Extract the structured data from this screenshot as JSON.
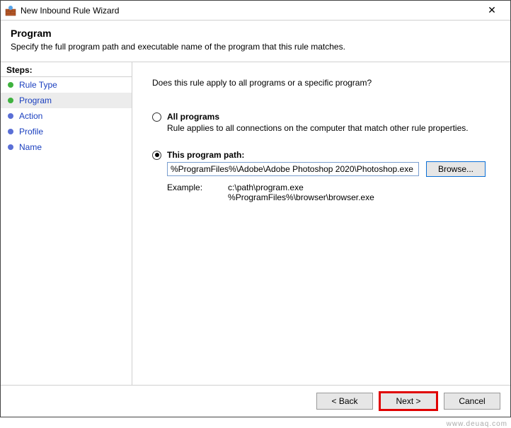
{
  "window": {
    "title": "New Inbound Rule Wizard"
  },
  "header": {
    "title": "Program",
    "subtitle": "Specify the full program path and executable name of the program that this rule matches."
  },
  "sidebar": {
    "heading": "Steps:",
    "items": [
      {
        "label": "Rule Type",
        "state": "done"
      },
      {
        "label": "Program",
        "state": "done",
        "current": true
      },
      {
        "label": "Action",
        "state": "pending"
      },
      {
        "label": "Profile",
        "state": "pending"
      },
      {
        "label": "Name",
        "state": "pending"
      }
    ]
  },
  "content": {
    "question": "Does this rule apply to all programs or a specific program?",
    "option_all": {
      "label": "All programs",
      "desc": "Rule applies to all connections on the computer that match other rule properties.",
      "selected": false
    },
    "option_path": {
      "label": "This program path:",
      "selected": true,
      "value": "%ProgramFiles%\\Adobe\\Adobe Photoshop 2020\\Photoshop.exe",
      "browse_label": "Browse..."
    },
    "example": {
      "label": "Example:",
      "values": "c:\\path\\program.exe\n%ProgramFiles%\\browser\\browser.exe"
    }
  },
  "footer": {
    "back": "< Back",
    "next": "Next >",
    "cancel": "Cancel"
  },
  "watermark": "www.deuaq.com"
}
